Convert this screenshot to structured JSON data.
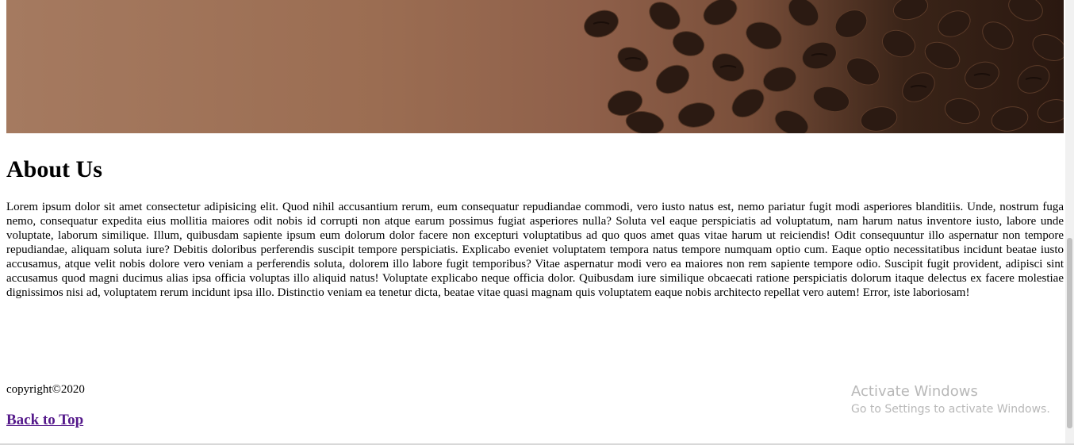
{
  "hero": {
    "image": "coffee-beans-banner"
  },
  "about": {
    "title": "About Us",
    "body": "Lorem ipsum dolor sit amet consectetur adipisicing elit. Quod nihil accusantium rerum, eum consequatur repudiandae commodi, vero iusto natus est, nemo pariatur fugit modi asperiores blanditiis. Unde, nostrum fuga nemo, consequatur expedita eius mollitia maiores odit nobis id corrupti non atque earum possimus fugiat asperiores nulla? Soluta vel eaque perspiciatis ad voluptatum, nam harum natus inventore iusto, labore unde voluptate, laborum similique. Illum, quibusdam sapiente ipsum eum dolorum dolor facere non excepturi voluptatibus ad quo quos amet quas vitae harum ut reiciendis! Odit consequuntur illo aspernatur non tempore repudiandae, aliquam soluta iure? Debitis doloribus perferendis suscipit tempore perspiciatis. Explicabo eveniet voluptatem tempora natus tempore numquam optio cum. Eaque optio necessitatibus incidunt beatae iusto accusamus, atque velit nobis dolore vero veniam a perferendis soluta, dolorem illo labore fugit temporibus? Vitae aspernatur modi vero ea maiores non rem sapiente tempore odio. Suscipit fugit provident, adipisci sint accusamus quod magni ducimus alias ipsa officia voluptas illo aliquid natus! Voluptate explicabo neque officia dolor. Quibusdam iure similique obcaecati ratione perspiciatis dolorum itaque delectus ex facere molestiae dignissimos nisi ad, voluptatem rerum incidunt ipsa illo. Distinctio veniam ea tenetur dicta, beatae vitae quasi magnam quis voluptatem eaque nobis architecto repellat vero autem! Error, iste laboriosam!"
  },
  "footer": {
    "copyright": "copyright©2020",
    "back_to_top": "Back to Top"
  },
  "watermark": {
    "title": "Activate Windows",
    "subtitle": "Go to Settings to activate Windows."
  },
  "colors": {
    "link_visited": "#551a8b",
    "watermark": "#b8b8b8"
  }
}
